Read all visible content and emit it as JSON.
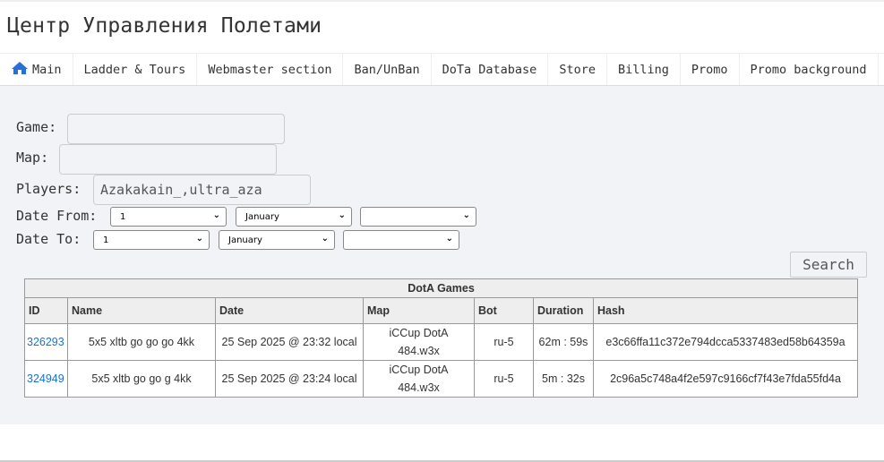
{
  "header": {
    "title": "Центр Управления Полетами"
  },
  "nav": {
    "items": [
      {
        "label": "Main",
        "icon": "home-icon"
      },
      {
        "label": "Ladder & Tours"
      },
      {
        "label": "Webmaster section"
      },
      {
        "label": "Ban/UnBan"
      },
      {
        "label": "DoTa Database"
      },
      {
        "label": "Store"
      },
      {
        "label": "Billing"
      },
      {
        "label": "Promo"
      },
      {
        "label": "Promo background"
      }
    ]
  },
  "form": {
    "game_label": "Game:",
    "game_value": "",
    "map_label": "Map:",
    "map_value": "",
    "players_label": "Players:",
    "players_value": "Azakakain_,ultra_aza",
    "date_from_label": "Date From:",
    "date_from": {
      "day": "1",
      "month": "January",
      "year": ""
    },
    "date_to_label": "Date To:",
    "date_to": {
      "day": "1",
      "month": "January",
      "year": ""
    },
    "search_label": "Search"
  },
  "table": {
    "caption": "DotA Games",
    "columns": [
      "ID",
      "Name",
      "Date",
      "Map",
      "Bot",
      "Duration",
      "Hash"
    ],
    "rows": [
      {
        "id": "326293",
        "name": "5x5 xltb go go go 4kk",
        "date": "25 Sep 2025 @ 23:32 local",
        "map1": "iCCup DotA",
        "map2": "484.w3x",
        "bot": "ru-5",
        "duration": "62m : 59s",
        "hash": "e3c66ffa11c372e794dcca5337483ed58b64359a"
      },
      {
        "id": "324949",
        "name": "5x5 xltb go go g 4kk",
        "date": "25 Sep 2025 @ 23:24 local",
        "map1": "iCCup DotA",
        "map2": "484.w3x",
        "bot": "ru-5",
        "duration": "5m : 32s",
        "hash": "2c96a5c748a4f2e597c9166cf7f43e7fda55fd4a"
      }
    ]
  },
  "colors": {
    "accent": "#1a6fd4",
    "background": "#f2f3f7"
  }
}
